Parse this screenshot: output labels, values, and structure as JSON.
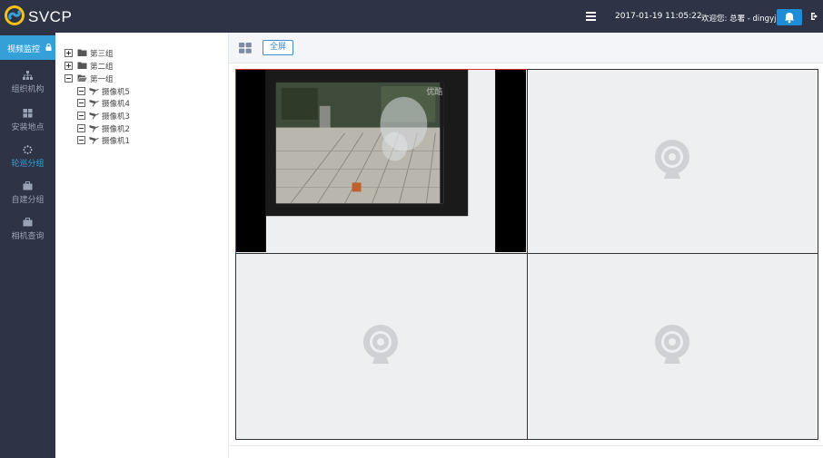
{
  "header": {
    "app_name": "SVCP",
    "datetime": "2017-01-19 11:05:22",
    "welcome": "欢迎您: 总署 - dingyj"
  },
  "nav": {
    "active_label": "视频监控",
    "items": [
      {
        "label": "组织机构",
        "icon": "sitemap-icon"
      },
      {
        "label": "安装地点",
        "icon": "grid-icon"
      },
      {
        "label": "轮巡分组",
        "icon": "spinner-icon"
      },
      {
        "label": "自建分组",
        "icon": "briefcase-icon"
      },
      {
        "label": "相机查询",
        "icon": "briefcase-icon"
      }
    ],
    "selected_index": 2
  },
  "tree": {
    "groups": [
      {
        "label": "第三组",
        "expanded": false
      },
      {
        "label": "第二组",
        "expanded": false
      },
      {
        "label": "第一组",
        "expanded": true
      }
    ],
    "cameras": [
      "摄像机5",
      "摄像机4",
      "摄像机3",
      "摄像机2",
      "摄像机1"
    ]
  },
  "toolbar": {
    "fullscreen_label": "全屏"
  },
  "video": {
    "watermark": "优酷",
    "accent_color": "#d12b2b",
    "brand_color": "#35a0d8"
  }
}
